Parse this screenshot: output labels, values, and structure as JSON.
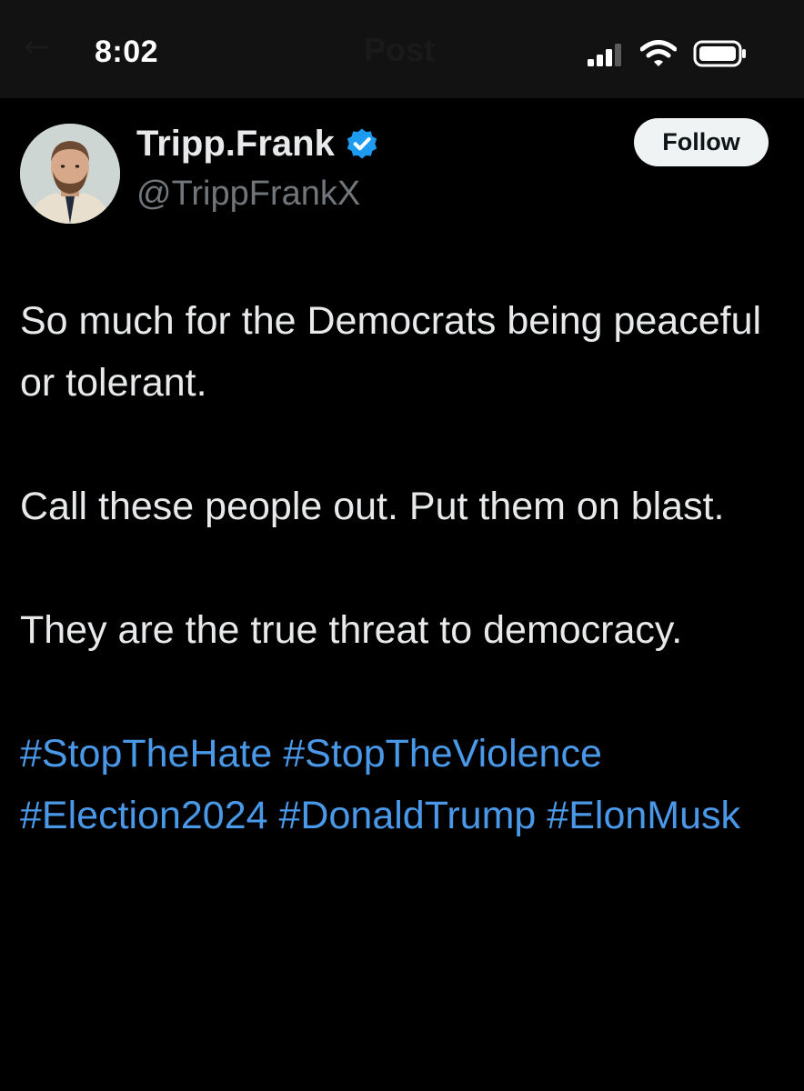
{
  "status_bar": {
    "time": "8:02"
  },
  "header": {
    "title_ghost": "Post"
  },
  "tweet": {
    "display_name": "Tripp.Frank",
    "handle": "@TrippFrankX",
    "follow_label": "Follow",
    "paragraphs": [
      "So much for the Democrats being peaceful or tolerant.",
      "Call these people out. Put them on blast.",
      "They are the true threat to democracy."
    ],
    "hashtags": [
      "#StopTheHate",
      "#StopTheViolence",
      "#Election2024",
      "#DonaldTrump",
      "#ElonMusk"
    ]
  },
  "icons": {
    "back": "arrow-left-icon",
    "signal": "cellular-signal-icon",
    "wifi": "wifi-icon",
    "battery": "battery-icon",
    "verified": "verified-badge-icon"
  },
  "colors": {
    "background": "#000000",
    "status_bar": "#121212",
    "text_primary": "#e7e9ea",
    "text_secondary": "#71767b",
    "hashtag_link": "#4a99e9",
    "verified_badge": "#1d9bf0",
    "follow_button_bg": "#eff3f4"
  }
}
